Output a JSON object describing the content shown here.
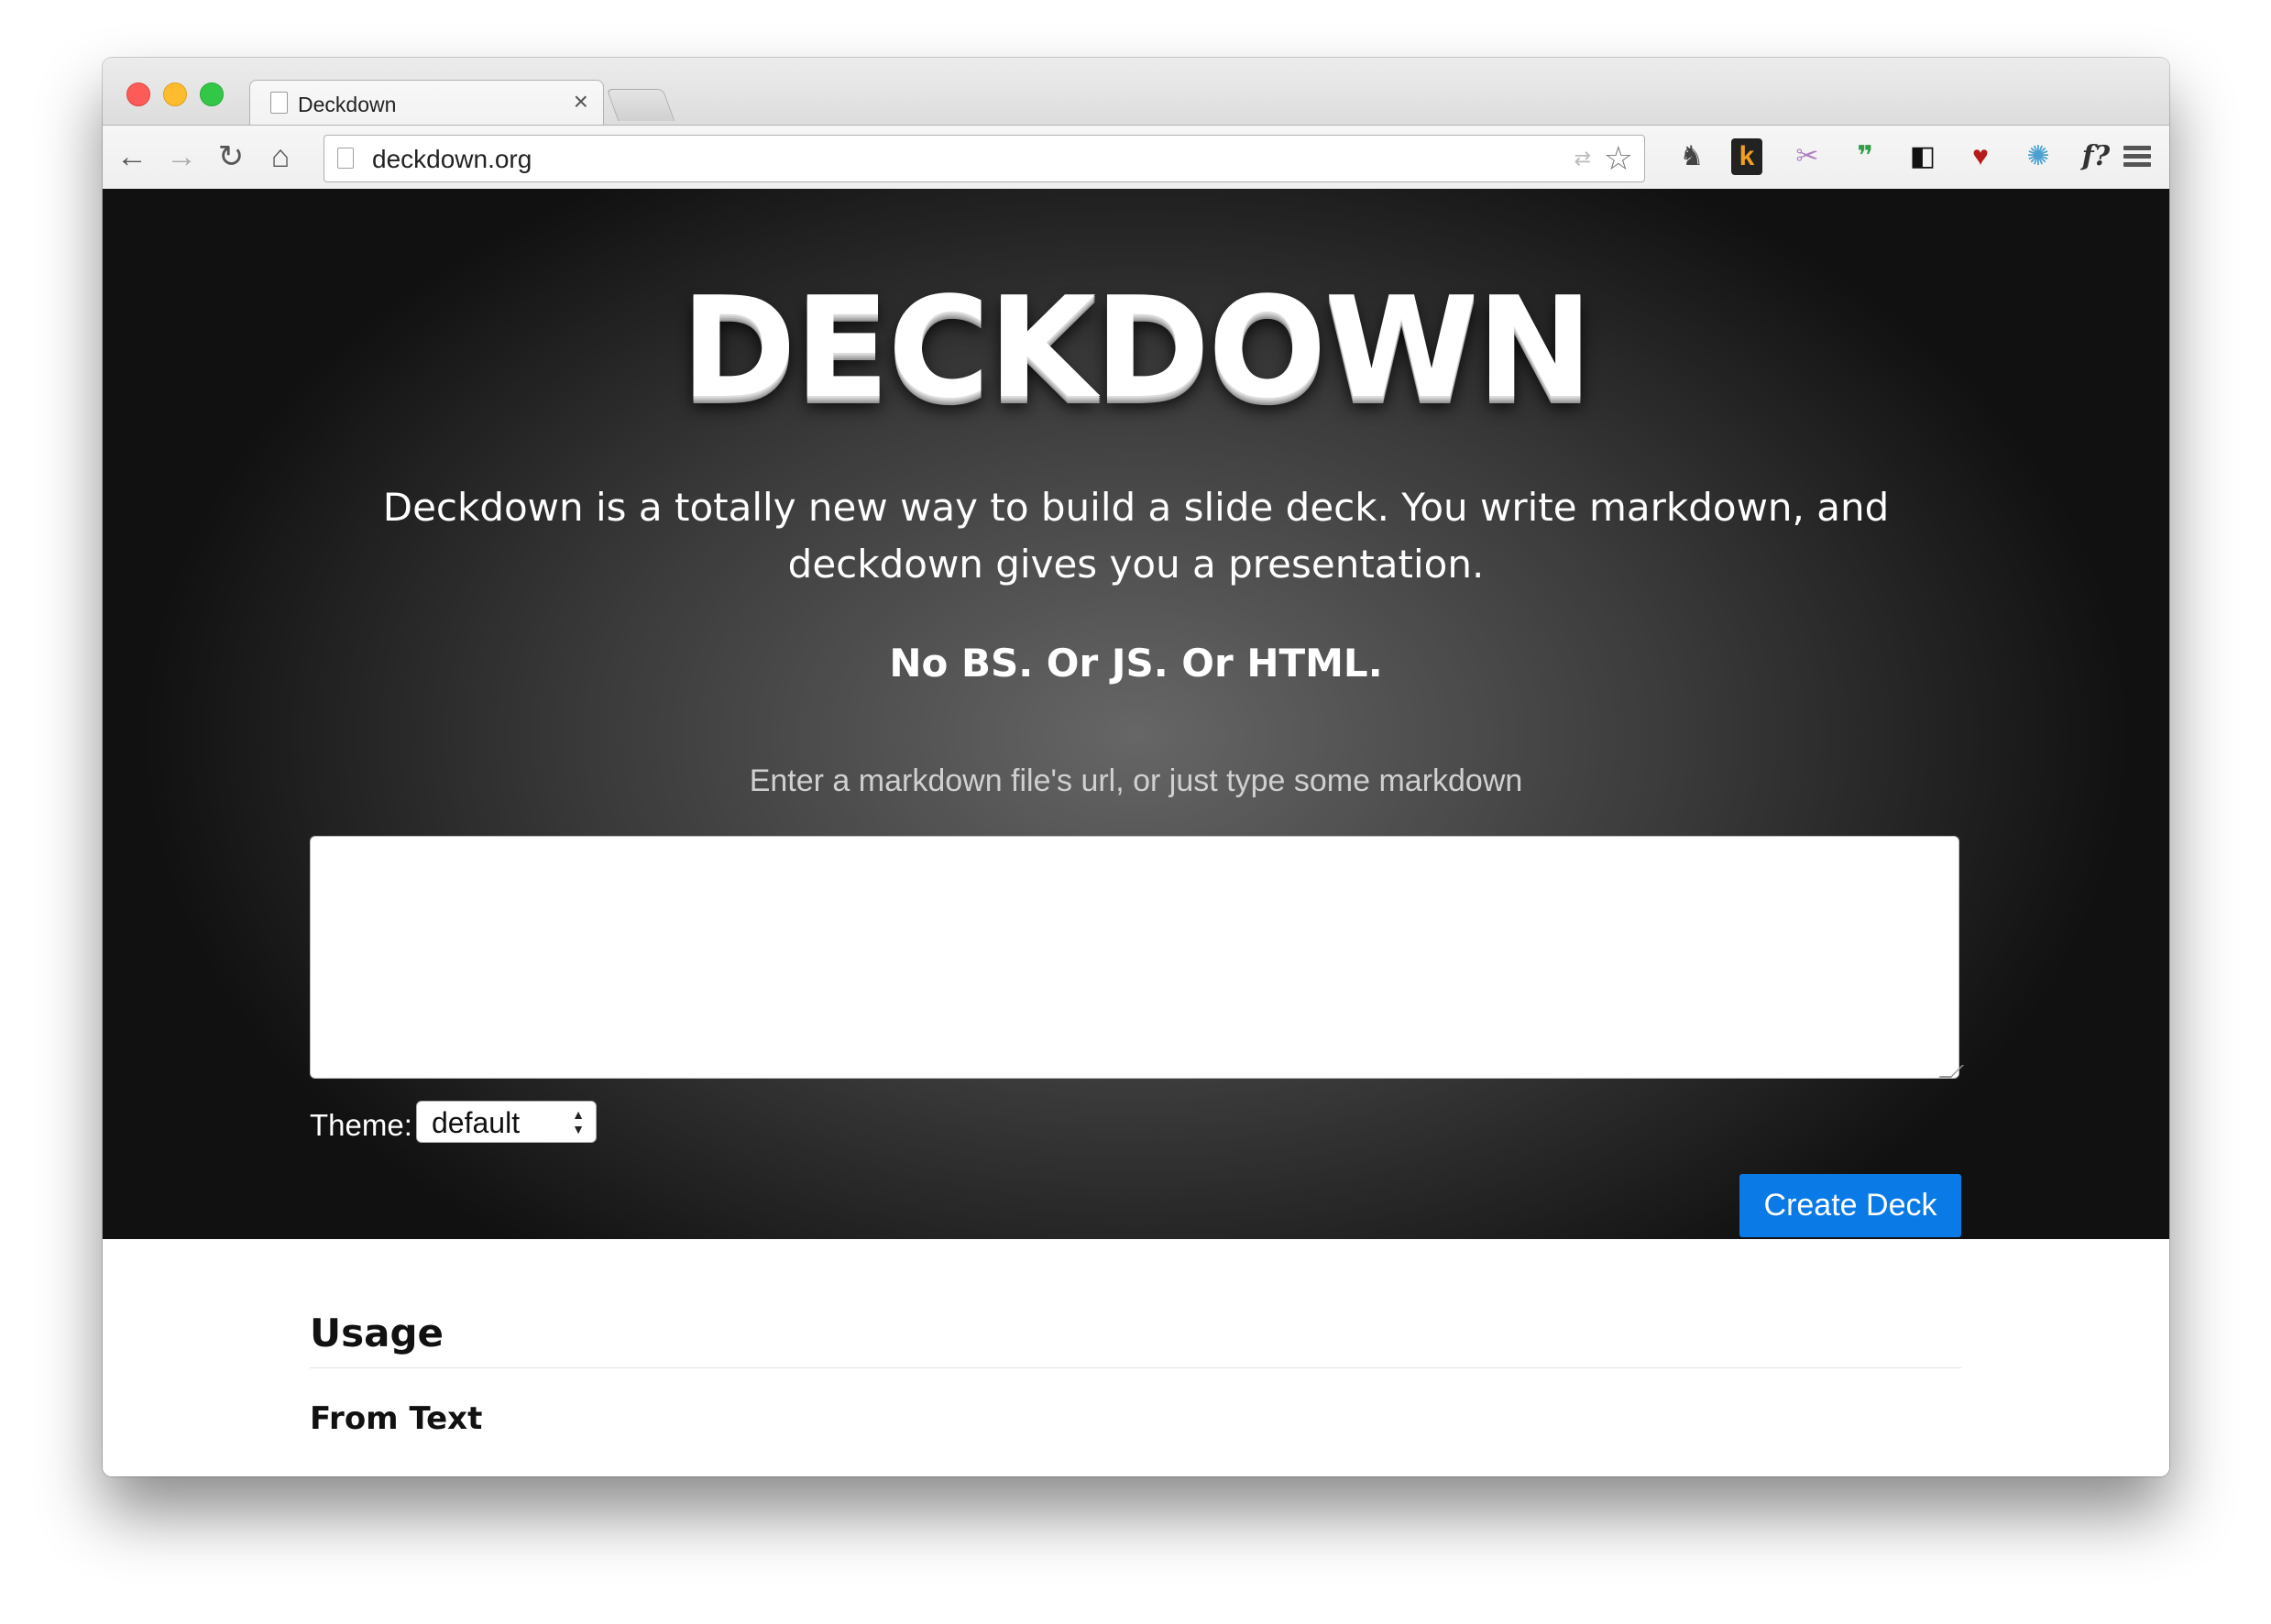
{
  "browser": {
    "tab_title": "Deckdown",
    "tab_close": "×",
    "url": "deckdown.org",
    "nav": {
      "back": "←",
      "forward": "→",
      "reload": "↻",
      "home": "⌂"
    },
    "star": "☆",
    "extensions": [
      {
        "name": "evernote-icon",
        "glyph": "♞",
        "color": "#444444"
      },
      {
        "name": "kindle-icon",
        "glyph": "k",
        "color": "#f0a020"
      },
      {
        "name": "puzzle-icon",
        "glyph": "✂",
        "color": "#b080c0"
      },
      {
        "name": "hangouts-icon",
        "glyph": "❞",
        "color": "#2e9e47"
      },
      {
        "name": "pocket-window-icon",
        "glyph": "◧",
        "color": "#111111"
      },
      {
        "name": "sofa-icon",
        "glyph": "♥",
        "color": "#b51b1b"
      },
      {
        "name": "bug-icon",
        "glyph": "✺",
        "color": "#4aa0d0"
      },
      {
        "name": "font-icon",
        "glyph": "f?",
        "color": "#333333"
      }
    ]
  },
  "hero": {
    "logo": "DECKDOWN",
    "tagline": "Deckdown is a totally new way to build a slide deck. You write markdown, and deckdown gives you a presentation.",
    "slogan": "No BS. Or JS. Or HTML.",
    "prompt": "Enter a markdown file's url, or just type some markdown",
    "input_value": "",
    "theme_label": "Theme:",
    "theme_selected": "default",
    "create_button": "Create Deck"
  },
  "content": {
    "usage_heading": "Usage",
    "from_text_heading": "From Text"
  },
  "colors": {
    "accent": "#0a7ae6",
    "hero_center": "#666666",
    "hero_edge": "#111111"
  }
}
